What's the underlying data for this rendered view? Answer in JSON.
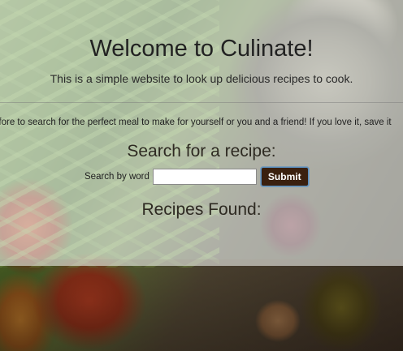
{
  "page": {
    "title": "Welcome to Culinate!",
    "subtitle": "This is a simple website to look up delicious recipes to cook.",
    "scrolling_text": "efore to search for the perfect meal to make for yourself or you and a friend! If you love it, save it"
  },
  "search": {
    "heading": "Search for a recipe:",
    "label": "Search by word",
    "value": "",
    "submit_label": "Submit"
  },
  "results": {
    "heading": "Recipes Found:"
  },
  "colors": {
    "panel_overlay": "#ebeee8",
    "submit_button": "#3a200f",
    "text": "#222222"
  }
}
